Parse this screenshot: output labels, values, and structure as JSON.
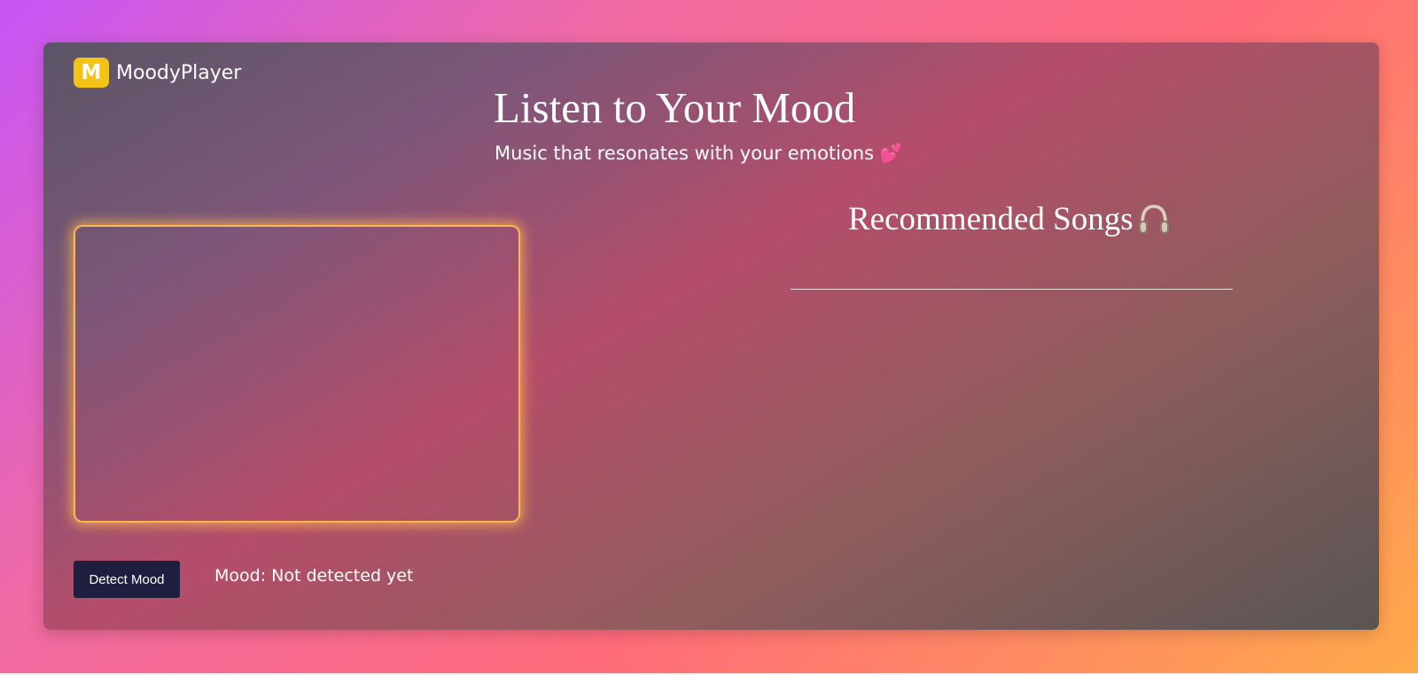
{
  "brand": {
    "logo_letter": "M",
    "name": "MoodyPlayer"
  },
  "hero": {
    "title": "Listen to Your Mood",
    "subtitle": "Music that resonates with your emotions 💕"
  },
  "camera": {
    "icon": "camera-preview"
  },
  "controls": {
    "detect_label": "Detect Mood",
    "mood_status": "Mood: Not detected yet"
  },
  "recommendations": {
    "title": "Recommended Songs",
    "icon": "headphone-icon",
    "songs": []
  },
  "colors": {
    "accent_logo": "#f5c216",
    "camera_glow": "#ffb64d",
    "button_bg": "#1e1e3f"
  }
}
